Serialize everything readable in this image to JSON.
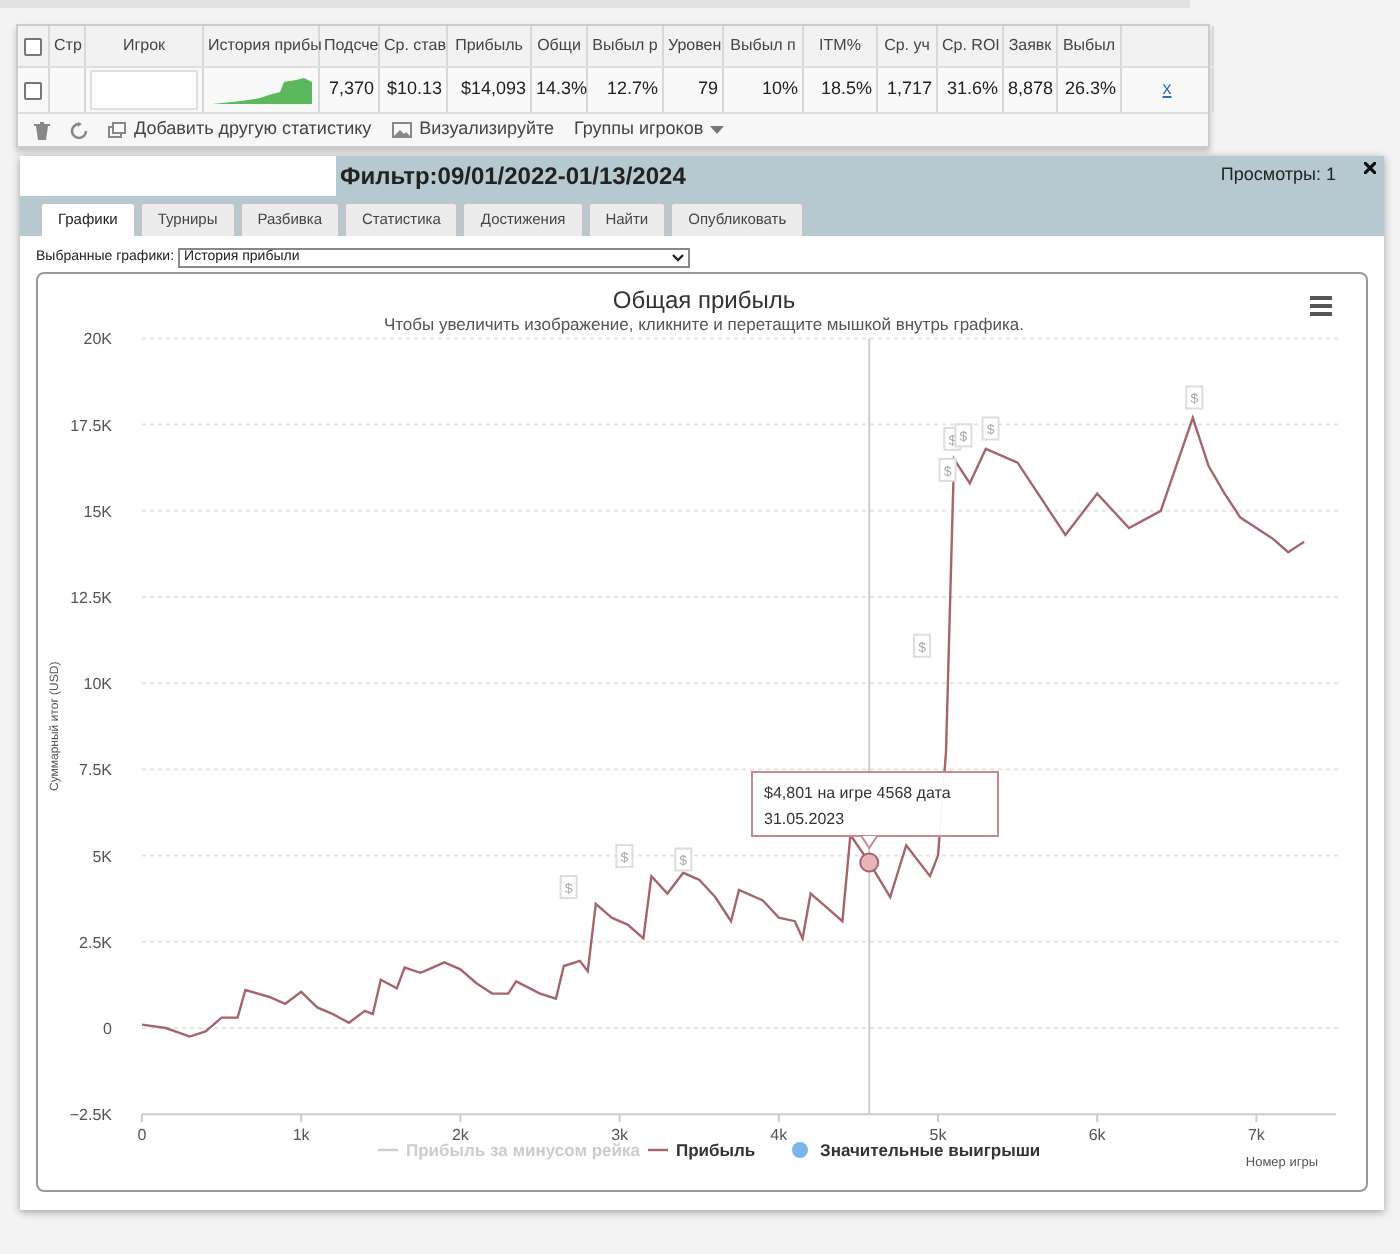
{
  "stats_table": {
    "columns": [
      {
        "kind": "checkbox",
        "checked": false
      },
      {
        "kind": "text",
        "label": "Стр"
      },
      {
        "kind": "text",
        "label": "Игрок"
      },
      {
        "kind": "text",
        "label": "История прибы"
      },
      {
        "kind": "text",
        "label": "Подсче"
      },
      {
        "kind": "text",
        "label": "Ср. став"
      },
      {
        "kind": "text",
        "label": "Прибыль"
      },
      {
        "kind": "text",
        "label": "Общи"
      },
      {
        "kind": "text",
        "label": "Выбыл р"
      },
      {
        "kind": "text",
        "label": "Уровен"
      },
      {
        "kind": "text",
        "label": "Выбыл п"
      },
      {
        "kind": "text",
        "label": "ITM%"
      },
      {
        "kind": "text",
        "label": "Ср. уч"
      },
      {
        "kind": "text",
        "label": "Ср. ROI"
      },
      {
        "kind": "text",
        "label": "Заявк"
      },
      {
        "kind": "text",
        "label": "Выбыл"
      },
      {
        "kind": "blank"
      }
    ],
    "row": [
      {
        "kind": "checkbox",
        "checked": false
      },
      {
        "kind": "blank"
      },
      {
        "kind": "field"
      },
      {
        "kind": "sparkline"
      },
      {
        "kind": "text",
        "text": "7,370"
      },
      {
        "kind": "text",
        "text": "$10.13"
      },
      {
        "kind": "text",
        "text": "$14,093"
      },
      {
        "kind": "text",
        "text": "14.3%"
      },
      {
        "kind": "text",
        "text": "12.7%"
      },
      {
        "kind": "text",
        "text": "79"
      },
      {
        "kind": "text",
        "text": "10%"
      },
      {
        "kind": "text",
        "text": "18.5%"
      },
      {
        "kind": "text",
        "text": "1,717"
      },
      {
        "kind": "text",
        "text": "31.6%"
      },
      {
        "kind": "text",
        "text": "8,878"
      },
      {
        "kind": "text",
        "text": "26.3%"
      },
      {
        "kind": "link",
        "text": "x"
      }
    ],
    "toolbar": [
      {
        "kind": "trash"
      },
      {
        "kind": "refresh"
      },
      {
        "kind": "add",
        "label": "Добавить другую статистику"
      },
      {
        "kind": "visualize",
        "label": "Визуализируйте"
      },
      {
        "kind": "menu",
        "label": "Группы игроков"
      }
    ]
  },
  "panel": {
    "filter_title": "Фильтр:09/01/2022-01/13/2024",
    "views": "Просмотры: 1",
    "tabs": [
      {
        "label": "Графики",
        "selected": true
      },
      {
        "label": "Турниры",
        "selected": false
      },
      {
        "label": "Разбивка",
        "selected": false
      },
      {
        "label": "Статистика",
        "selected": false
      },
      {
        "label": "Достижения",
        "selected": false
      },
      {
        "label": "Найти",
        "selected": false
      },
      {
        "label": "Опубликовать",
        "selected": false
      }
    ],
    "graph_select": {
      "label": "Выбранные графики:",
      "value": "История прибыли"
    },
    "chart": {
      "subtitle": "Чтобы увеличить изображение, кликните и перетащите мышкой внутрь графика.",
      "tooltip": {
        "line_1": "$4,801 на игре 4568 дата",
        "line_2": "31.05.2023"
      },
      "legend": [
        {
          "label": "Прибыль за минусом рейка",
          "visible": false,
          "kind": "line"
        },
        {
          "visible": true,
          "kind": "series"
        },
        {
          "label": "Значительные выигрыши",
          "visible": true,
          "kind": "dot"
        }
      ],
      "chart_data": {
        "type": "line",
        "title": "Общая прибыль",
        "xlabel": "Номер игры",
        "ylabel": "Суммарный итог (USD)",
        "xlim": [
          0,
          7500
        ],
        "ylim": [
          -2500,
          20000
        ],
        "grid": true,
        "ref_lines": [
          {
            "axis": "x",
            "value": 4568
          }
        ],
        "xticks": [
          {
            "value": 0,
            "label": "0"
          },
          {
            "value": 1000,
            "label": "1k"
          },
          {
            "value": 2000,
            "label": "2k"
          },
          {
            "value": 3000,
            "label": "3k"
          },
          {
            "value": 4000,
            "label": "4k"
          },
          {
            "value": 5000,
            "label": "5k"
          },
          {
            "value": 6000,
            "label": "6k"
          },
          {
            "value": 7000,
            "label": "7k"
          }
        ],
        "yticks": [
          {
            "value": -2500,
            "label": "−2.5K"
          },
          {
            "value": 0,
            "label": "0"
          },
          {
            "value": 2500,
            "label": "2.5K"
          },
          {
            "value": 5000,
            "label": "5K"
          },
          {
            "value": 7500,
            "label": "7.5K"
          },
          {
            "value": 10000,
            "label": "10K"
          },
          {
            "value": 12500,
            "label": "12.5K"
          },
          {
            "value": 15000,
            "label": "15K"
          },
          {
            "value": 17500,
            "label": "17.5K"
          },
          {
            "value": 20000,
            "label": "20K"
          }
        ],
        "x": [
          0,
          150,
          300,
          400,
          500,
          600,
          650,
          800,
          900,
          1000,
          1100,
          1200,
          1300,
          1400,
          1450,
          1500,
          1600,
          1650,
          1750,
          1800,
          1900,
          2000,
          2100,
          2200,
          2300,
          2350,
          2500,
          2600,
          2650,
          2750,
          2800,
          2850,
          2950,
          3050,
          3150,
          3200,
          3300,
          3400,
          3500,
          3600,
          3700,
          3750,
          3900,
          4000,
          4100,
          4150,
          4200,
          4300,
          4400,
          4450,
          4568,
          4700,
          4800,
          4950,
          5000,
          5050,
          5100,
          5200,
          5300,
          5500,
          5700,
          5800,
          6000,
          6200,
          6400,
          6600,
          6700,
          6800,
          6900,
          7000,
          7100,
          7200,
          7300
        ],
        "series": [
          {
            "name": "Прибыль",
            "color": "#a5656b",
            "values": [
              100,
              0,
              -250,
              -100,
              300,
              300,
              1100,
              900,
              700,
              1050,
              600,
              400,
              150,
              500,
              400,
              1400,
              1150,
              1750,
              1600,
              1700,
              1900,
              1700,
              1300,
              1000,
              1000,
              1350,
              1000,
              850,
              1800,
              1950,
              1650,
              3600,
              3200,
              3000,
              2600,
              4400,
              3900,
              4500,
              4300,
              3800,
              3100,
              4000,
              3700,
              3200,
              3100,
              2600,
              3900,
              3500,
              3100,
              5600,
              4800,
              3800,
              5300,
              4400,
              5000,
              8000,
              16500,
              15800,
              16800,
              16400,
              15000,
              14300,
              15500,
              14500,
              15000,
              17700,
              16300,
              15500,
              14800,
              14500,
              14200,
              13800,
              14100
            ]
          }
        ],
        "annotations": [
          {
            "x": 2680,
            "y": 4000,
            "text": "$"
          },
          {
            "x": 3030,
            "y": 4900,
            "text": "$"
          },
          {
            "x": 3400,
            "y": 4800,
            "text": "$"
          },
          {
            "x": 4900,
            "y": 11000,
            "text": "$"
          },
          {
            "x": 5060,
            "y": 16100,
            "text": "$"
          },
          {
            "x": 5090,
            "y": 17000,
            "text": "$"
          },
          {
            "x": 5160,
            "y": 17100,
            "text": "$"
          },
          {
            "x": 5330,
            "y": 17300,
            "text": "$"
          },
          {
            "x": 6610,
            "y": 18200,
            "text": "$"
          }
        ]
      }
    }
  }
}
